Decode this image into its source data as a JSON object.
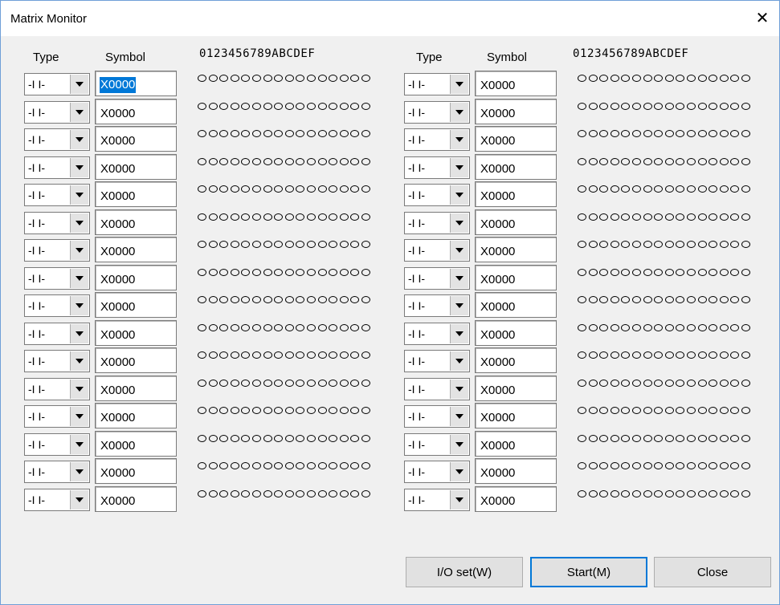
{
  "window": {
    "title": "Matrix Monitor",
    "close_glyph": "✕"
  },
  "headers": {
    "type": "Type",
    "symbol": "Symbol",
    "hex": "0123456789ABCDEF"
  },
  "rows_left": [
    {
      "type": "-I I-",
      "symbol": "X0000",
      "selected": true
    },
    {
      "type": "-I I-",
      "symbol": "X0000"
    },
    {
      "type": "-I I-",
      "symbol": "X0000"
    },
    {
      "type": "-I I-",
      "symbol": "X0000"
    },
    {
      "type": "-I I-",
      "symbol": "X0000"
    },
    {
      "type": "-I I-",
      "symbol": "X0000"
    },
    {
      "type": "-I I-",
      "symbol": "X0000"
    },
    {
      "type": "-I I-",
      "symbol": "X0000"
    },
    {
      "type": "-I I-",
      "symbol": "X0000"
    },
    {
      "type": "-I I-",
      "symbol": "X0000"
    },
    {
      "type": "-I I-",
      "symbol": "X0000"
    },
    {
      "type": "-I I-",
      "symbol": "X0000"
    },
    {
      "type": "-I I-",
      "symbol": "X0000"
    },
    {
      "type": "-I I-",
      "symbol": "X0000"
    },
    {
      "type": "-I I-",
      "symbol": "X0000"
    },
    {
      "type": "-I I-",
      "symbol": "X0000"
    }
  ],
  "rows_right": [
    {
      "type": "-I I-",
      "symbol": "X0000"
    },
    {
      "type": "-I I-",
      "symbol": "X0000"
    },
    {
      "type": "-I I-",
      "symbol": "X0000"
    },
    {
      "type": "-I I-",
      "symbol": "X0000"
    },
    {
      "type": "-I I-",
      "symbol": "X0000"
    },
    {
      "type": "-I I-",
      "symbol": "X0000"
    },
    {
      "type": "-I I-",
      "symbol": "X0000"
    },
    {
      "type": "-I I-",
      "symbol": "X0000"
    },
    {
      "type": "-I I-",
      "symbol": "X0000"
    },
    {
      "type": "-I I-",
      "symbol": "X0000"
    },
    {
      "type": "-I I-",
      "symbol": "X0000"
    },
    {
      "type": "-I I-",
      "symbol": "X0000"
    },
    {
      "type": "-I I-",
      "symbol": "X0000"
    },
    {
      "type": "-I I-",
      "symbol": "X0000"
    },
    {
      "type": "-I I-",
      "symbol": "X0000"
    },
    {
      "type": "-I I-",
      "symbol": "X0000"
    }
  ],
  "bit_count": 16,
  "buttons": {
    "io_set": "I/O set(W)",
    "start": "Start(M)",
    "close": "Close"
  },
  "colors": {
    "selection": "#0078d7",
    "focus_border": "#0078d7"
  }
}
